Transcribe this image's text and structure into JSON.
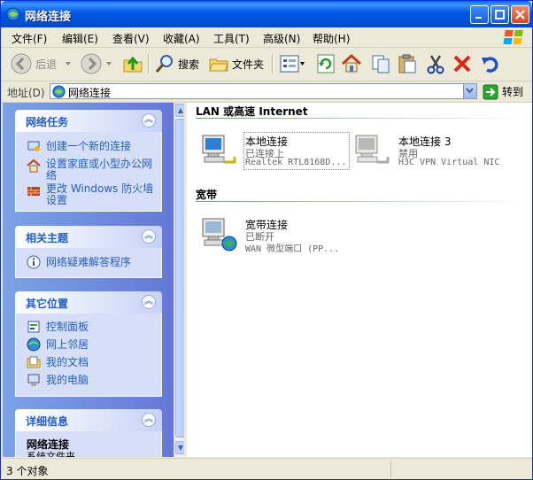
{
  "window": {
    "title": "网络连接"
  },
  "menu": [
    {
      "label": "文件(F)"
    },
    {
      "label": "编辑(E)"
    },
    {
      "label": "查看(V)"
    },
    {
      "label": "收藏(A)"
    },
    {
      "label": "工具(T)"
    },
    {
      "label": "高级(N)"
    },
    {
      "label": "帮助(H)"
    }
  ],
  "toolbar": {
    "back_label": "后退",
    "search_label": "搜索",
    "folders_label": "文件夹"
  },
  "address": {
    "label": "地址(D)",
    "value": "网络连接",
    "go_label": "转到"
  },
  "left": {
    "network_tasks": {
      "title": "网络任务",
      "items": [
        "创建一个新的连接",
        "设置家庭或小型办公网络",
        "更改 Windows 防火墙设置"
      ]
    },
    "related": {
      "title": "相关主题",
      "items": [
        "网络疑难解答程序"
      ]
    },
    "other_places": {
      "title": "其它位置",
      "items": [
        "控制面板",
        "网上邻居",
        "我的文档",
        "我的电脑"
      ]
    },
    "details": {
      "title": "详细信息",
      "name": "网络连接",
      "type": "系统文件夹"
    }
  },
  "main": {
    "groups": [
      {
        "title": "LAN 或高速 Internet",
        "items": [
          {
            "name": "本地连接",
            "status": "已连接上",
            "device": "Realtek RTL8168D..."
          },
          {
            "name": "本地连接 3",
            "status": "禁用",
            "device": "H3C VPN Virtual NIC"
          }
        ]
      },
      {
        "title": "宽带",
        "items": [
          {
            "name": "宽带连接",
            "status": "已断开",
            "device": "WAN 微型端口 (PP..."
          }
        ]
      }
    ]
  },
  "status": {
    "text": "3 个对象"
  },
  "colors": {
    "title_bar": "#0058e6",
    "task_link": "#215dc6",
    "panel": "#7ba2e7"
  }
}
